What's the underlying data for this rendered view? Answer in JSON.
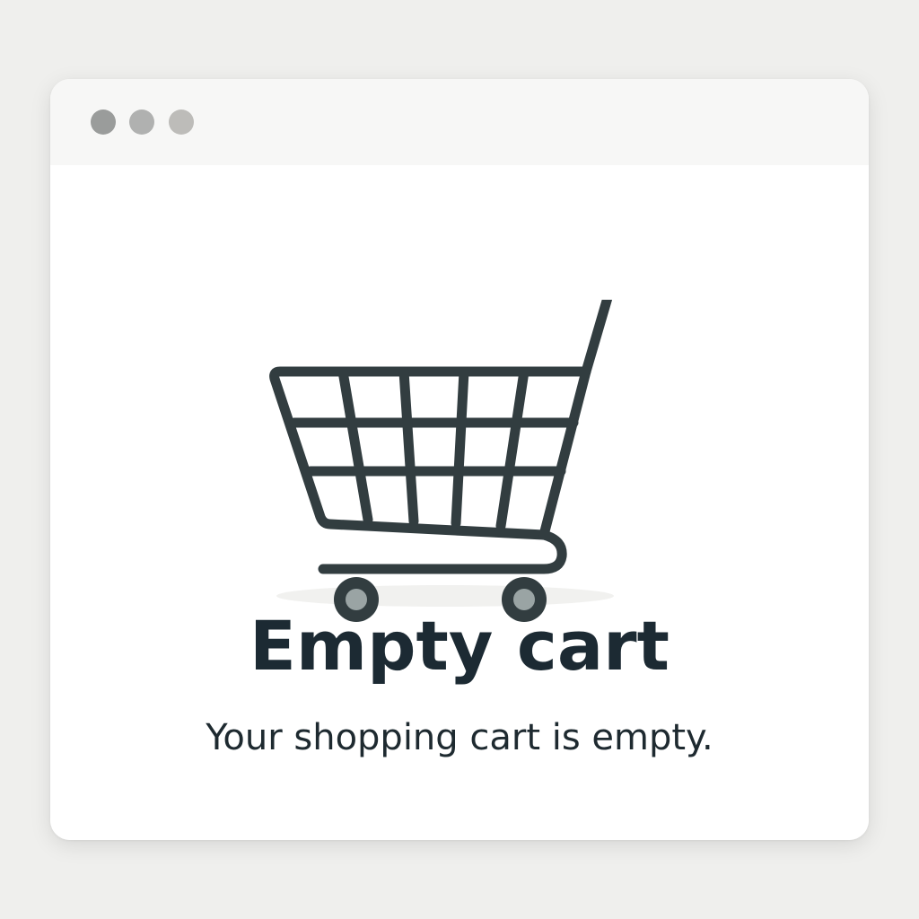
{
  "window": {
    "controls": [
      "window-dot",
      "window-dot",
      "window-dot"
    ]
  },
  "colors": {
    "background": "#efefed",
    "titlebar": "#f7f7f6",
    "dot_1": "#9a9c9b",
    "dot_2": "#b0b1b0",
    "dot_3": "#bdbcb9",
    "cart_stroke": "#323d40",
    "wheel_hub": "#9aa4a4",
    "title_text": "#1c2a33"
  },
  "empty_state": {
    "icon": "shopping-cart-icon",
    "title": "Empty cart",
    "message": "Your shopping cart is empty."
  }
}
